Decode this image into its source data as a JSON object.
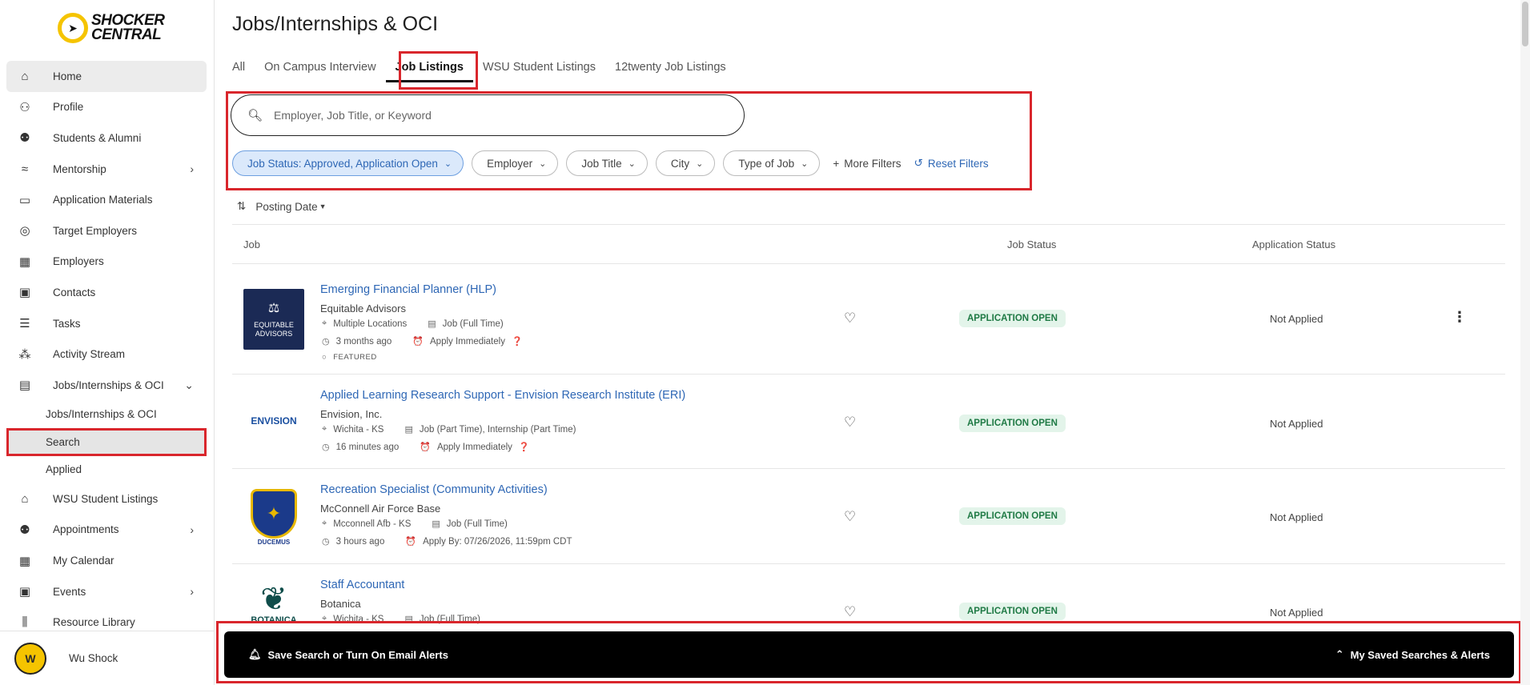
{
  "app": {
    "logo_line1": "SHOCKER",
    "logo_line2": "CENTRAL"
  },
  "sidebar": {
    "items": [
      {
        "label": "Home",
        "icon": "home-icon",
        "glyph": "⌂"
      },
      {
        "label": "Profile",
        "icon": "person-icon",
        "glyph": "👤"
      },
      {
        "label": "Students & Alumni",
        "icon": "people-icon",
        "glyph": "👥"
      },
      {
        "label": "Mentorship",
        "icon": "mentorship-icon",
        "glyph": "⟿"
      },
      {
        "label": "Application Materials",
        "icon": "folder-icon",
        "glyph": "🗀"
      },
      {
        "label": "Target Employers",
        "icon": "target-icon",
        "glyph": "◎"
      },
      {
        "label": "Employers",
        "icon": "building-icon",
        "glyph": "▦"
      },
      {
        "label": "Contacts",
        "icon": "contact-card-icon",
        "glyph": "▣"
      },
      {
        "label": "Tasks",
        "icon": "checklist-icon",
        "glyph": "☰"
      },
      {
        "label": "Activity Stream",
        "icon": "activity-icon",
        "glyph": "⁂"
      },
      {
        "label": "Jobs/Internships & OCI",
        "icon": "briefcase-icon",
        "glyph": "💼"
      }
    ],
    "sub_items": [
      "Jobs/Internships & OCI",
      "Search",
      "Applied"
    ],
    "items_after": [
      {
        "label": "WSU Student Listings",
        "icon": "campus-icon",
        "glyph": "🏛"
      },
      {
        "label": "Appointments",
        "icon": "appointments-icon",
        "glyph": "👥"
      },
      {
        "label": "My Calendar",
        "icon": "calendar-icon",
        "glyph": "📅"
      },
      {
        "label": "Events",
        "icon": "event-icon",
        "glyph": "📆"
      },
      {
        "label": "Resource Library",
        "icon": "library-icon",
        "glyph": "📚"
      }
    ],
    "user_name": "Wu Shock"
  },
  "main": {
    "title": "Jobs/Internships & OCI",
    "tabs": [
      "All",
      "On Campus Interview",
      "Job Listings",
      "WSU Student Listings",
      "12twenty Job Listings"
    ],
    "search_placeholder": "Employer, Job Title, or Keyword",
    "filters": {
      "job_status": "Job Status: Approved, Application Open",
      "employer": "Employer",
      "job_title": "Job Title",
      "city": "City",
      "type_of_job": "Type of Job",
      "more": "More Filters",
      "reset": "Reset Filters"
    },
    "sort_label": "Posting Date",
    "columns": {
      "job": "Job",
      "job_status": "Job Status",
      "application_status": "Application Status"
    },
    "jobs": [
      {
        "title": "Emerging Financial Planner (HLP)",
        "employer": "Equitable Advisors",
        "location": "Multiple Locations",
        "type": "Job (Full Time)",
        "posted": "3 months ago",
        "apply": "Apply Immediately",
        "featured": "FEATURED",
        "status": "APPLICATION OPEN",
        "app_status": "Not Applied",
        "logo_text": "EQUITABLE ADVISORS"
      },
      {
        "title": "Applied Learning Research Support - Envision Research Institute (ERI)",
        "employer": "Envision, Inc.",
        "location": "Wichita - KS",
        "type": "Job (Part Time), Internship (Part Time)",
        "posted": "16 minutes ago",
        "apply": "Apply Immediately",
        "status": "APPLICATION OPEN",
        "app_status": "Not Applied",
        "logo_text": "ENVISION"
      },
      {
        "title": "Recreation Specialist (Community Activities)",
        "employer": "McConnell Air Force Base",
        "location": "Mcconnell Afb - KS",
        "type": "Job (Full Time)",
        "posted": "3 hours ago",
        "apply": "Apply By: 07/26/2026, 11:59pm CDT",
        "status": "APPLICATION OPEN",
        "app_status": "Not Applied",
        "logo_text": "DUCEMUS"
      },
      {
        "title": "Staff Accountant",
        "employer": "Botanica",
        "location": "Wichita - KS",
        "type": "Job (Full Time)",
        "status": "APPLICATION OPEN",
        "app_status": "Not Applied",
        "logo_text": "BOTANICA"
      }
    ]
  },
  "bottom_bar": {
    "left": "Save Search or Turn On Email Alerts",
    "right": "My Saved Searches & Alerts"
  },
  "colors": {
    "accent": "#2e67b5",
    "highlight": "#d9262c",
    "status_green": "#1f7a45"
  }
}
